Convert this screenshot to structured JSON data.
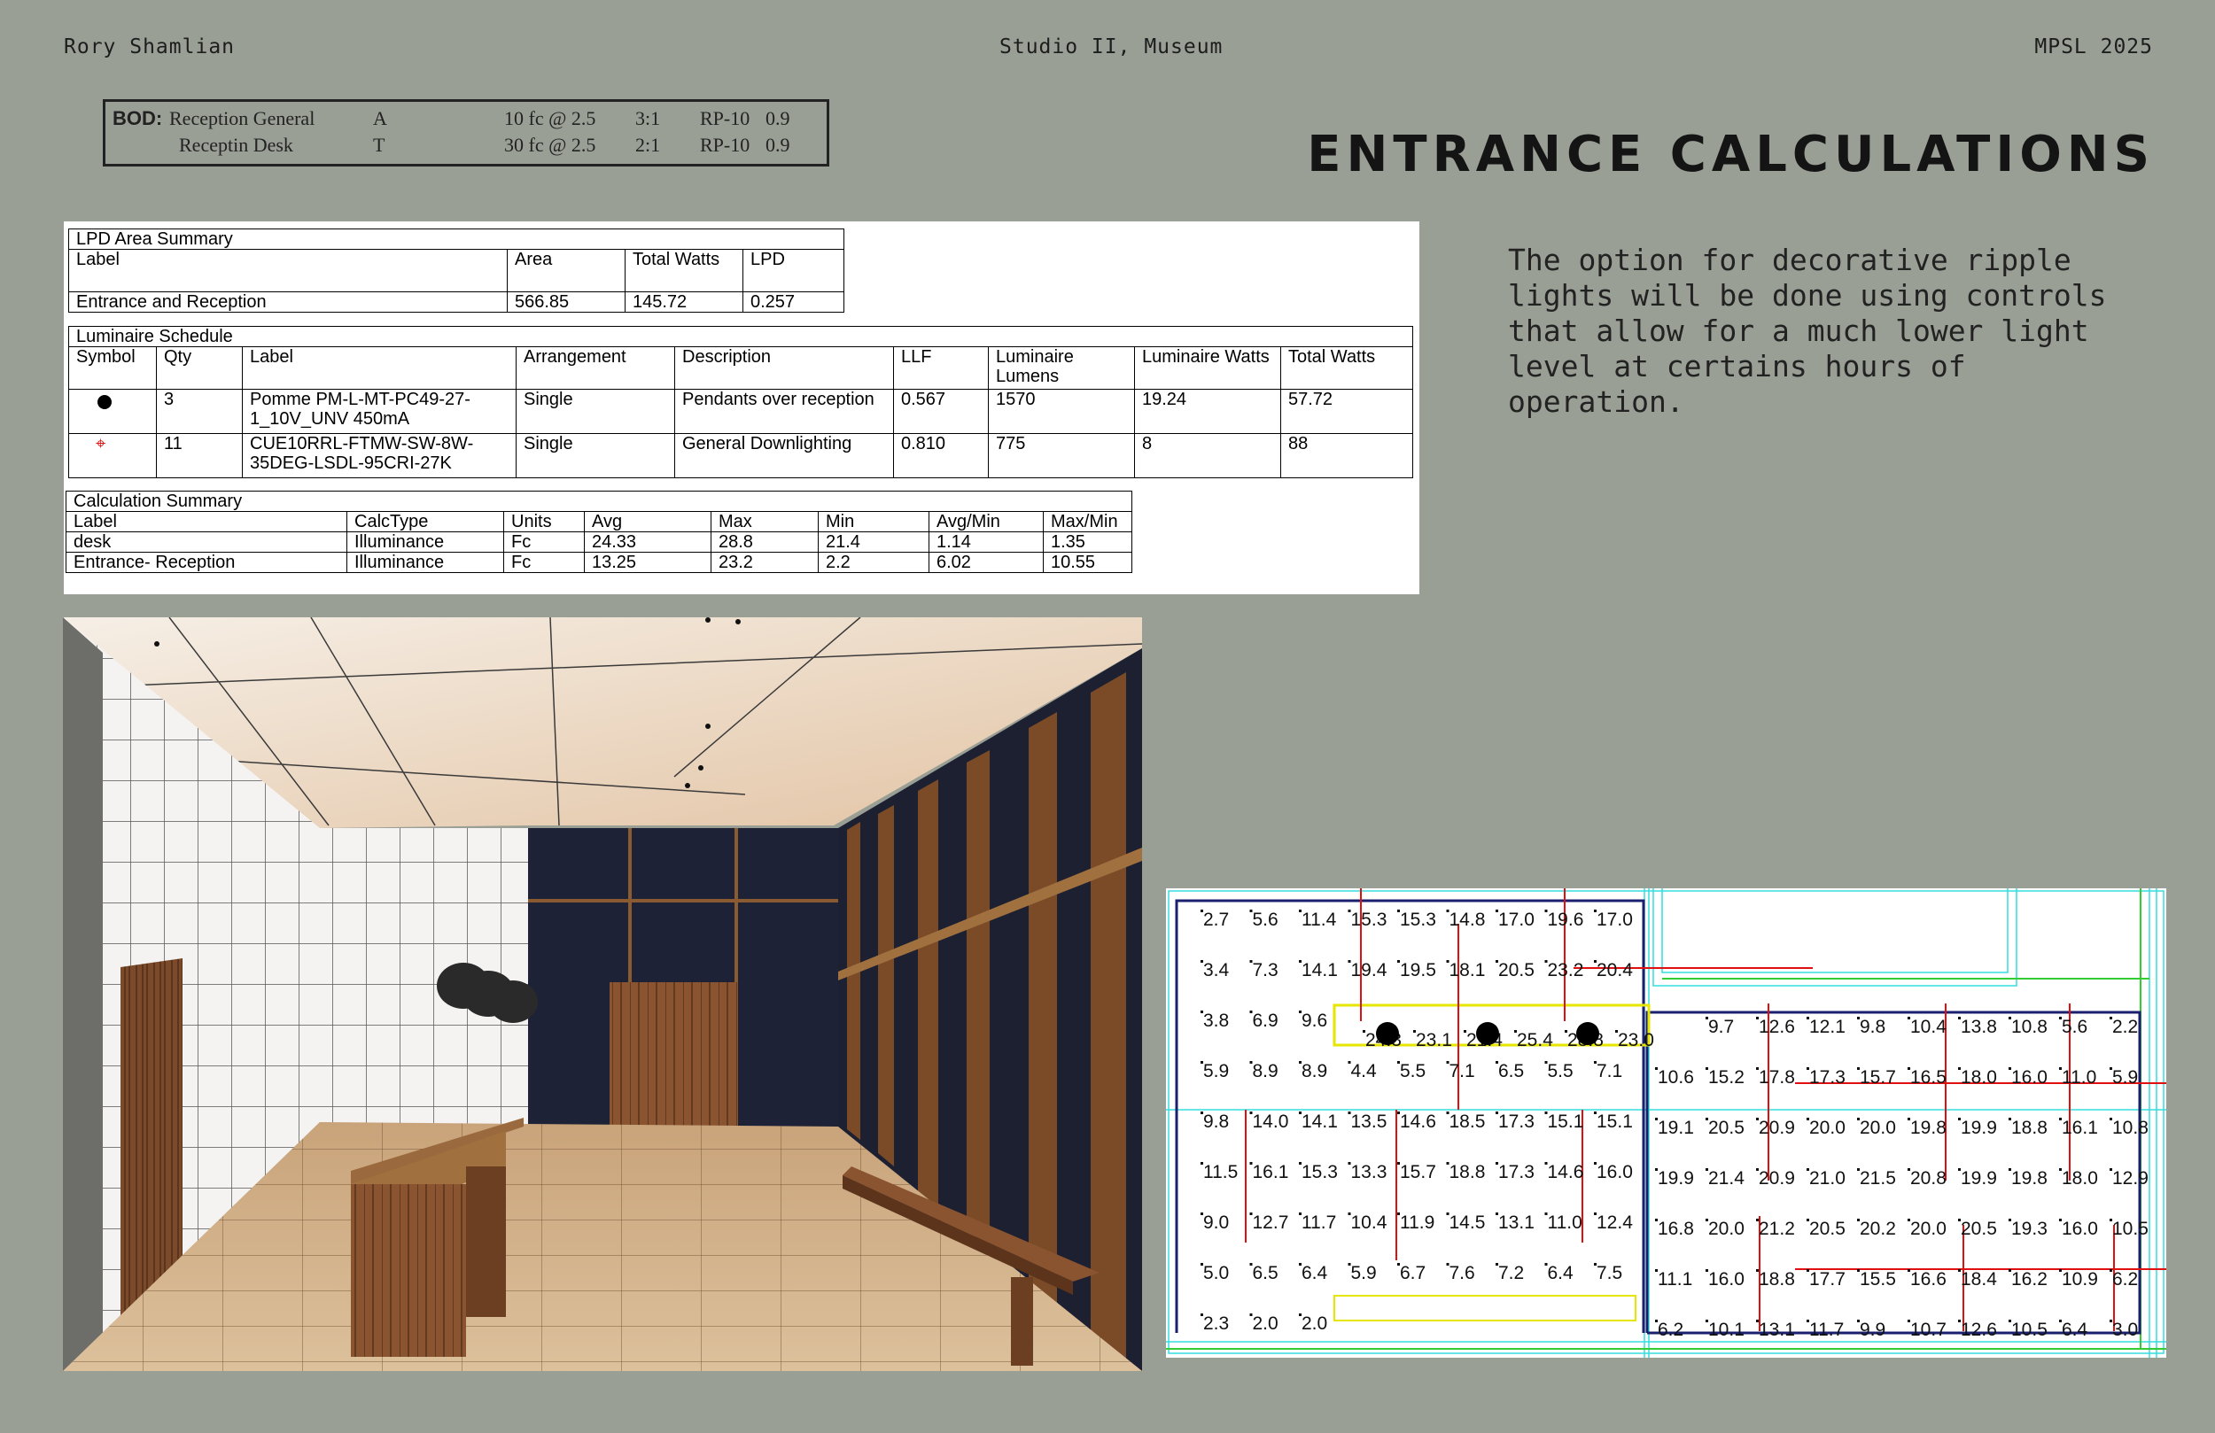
{
  "header": {
    "author": "Rory Shamlian",
    "course": "Studio II, Museum",
    "program": "MPSL 2025"
  },
  "title": "ENTRANCE CALCULATIONS",
  "description": "The option for decorative ripple lights will be done using controls that allow for a much lower light level at certains hours of operation.",
  "bod": {
    "label": "BOD:",
    "rows": [
      {
        "space": "Reception General",
        "cat": "A",
        "target": "10 fc @ 2.5",
        "ratio": "3:1",
        "ref": "RP-10",
        "val": "0.9"
      },
      {
        "space": "Receptin Desk",
        "cat": "T",
        "target": "30 fc @ 2.5",
        "ratio": "2:1",
        "ref": "RP-10",
        "val": "0.9"
      }
    ]
  },
  "lpd": {
    "title": "LPD Area Summary",
    "headers": [
      "Label",
      "Area",
      "Total Watts",
      "LPD"
    ],
    "row": [
      "Entrance and Reception",
      "566.85",
      "145.72",
      "0.257"
    ]
  },
  "schedule": {
    "title": "Luminaire Schedule",
    "headers": [
      "Symbol",
      "Qty",
      "Label",
      "Arrangement",
      "Description",
      "LLF",
      "Luminaire Lumens",
      "Luminaire Watts",
      "Total Watts"
    ],
    "rows": [
      {
        "symbol": "pendant-symbol",
        "qty": "3",
        "label": "Pomme PM-L-MT-PC49-27-1_10V_UNV 450mA",
        "arr": "Single",
        "desc": "Pendants over reception",
        "llf": "0.567",
        "lumens": "1570",
        "watts": "19.24",
        "total": "57.72"
      },
      {
        "symbol": "downlight-symbol",
        "qty": "11",
        "label": "CUE10RRL-FTMW-SW-8W-35DEG-LSDL-95CRI-27K",
        "arr": "Single",
        "desc": "General Downlighting",
        "llf": "0.810",
        "lumens": "775",
        "watts": "8",
        "total": "88"
      }
    ]
  },
  "calc": {
    "title": "Calculation Summary",
    "headers": [
      "Label",
      "CalcType",
      "Units",
      "Avg",
      "Max",
      "Min",
      "Avg/Min",
      "Max/Min"
    ],
    "rows": [
      [
        "desk",
        "Illuminance",
        "Fc",
        "24.33",
        "28.8",
        "21.4",
        "1.14",
        "1.35"
      ],
      [
        "Entrance- Reception",
        "Illuminance",
        "Fc",
        "13.25",
        "23.2",
        "2.2",
        "6.02",
        "10.55"
      ]
    ]
  },
  "plan": {
    "left_rows": [
      [
        "2.7",
        "5.6",
        "11.4",
        "15.3",
        "15.3",
        "14.8",
        "17.0",
        "19.6",
        "17.0"
      ],
      [
        "3.4",
        "7.3",
        "14.1",
        "19.4",
        "19.5",
        "18.1",
        "20.5",
        "23.2",
        "20.4"
      ],
      [
        "3.8",
        "6.9",
        "9.6",
        "",
        "",
        "",
        "",
        "",
        ""
      ],
      [
        "5.9",
        "8.9",
        "8.9",
        "4.4",
        "5.5",
        "7.1",
        "6.5",
        "5.5",
        "7.1"
      ],
      [
        "9.8",
        "14.0",
        "14.1",
        "13.5",
        "14.6",
        "18.5",
        "17.3",
        "15.1",
        "15.1"
      ],
      [
        "11.5",
        "16.1",
        "15.3",
        "13.3",
        "15.7",
        "18.8",
        "17.3",
        "14.6",
        "16.0"
      ],
      [
        "9.0",
        "12.7",
        "11.7",
        "10.4",
        "11.9",
        "14.5",
        "13.1",
        "11.0",
        "12.4"
      ],
      [
        "5.0",
        "6.5",
        "6.4",
        "5.9",
        "6.7",
        "7.6",
        "7.2",
        "6.4",
        "7.5"
      ],
      [
        "2.3",
        "2.0",
        "2.0",
        "",
        "",
        "",
        "",
        "",
        ""
      ]
    ],
    "desk_row": [
      "24.3",
      "23.1",
      "21.4",
      "25.4",
      "28.8",
      "23.0"
    ],
    "right_rows": [
      [
        "",
        "9.7",
        "12.6",
        "12.1",
        "9.8",
        "10.4",
        "13.8",
        "10.8",
        "5.6",
        "2.2"
      ],
      [
        "10.6",
        "15.2",
        "17.8",
        "17.3",
        "15.7",
        "16.5",
        "18.0",
        "16.0",
        "11.0",
        "5.9"
      ],
      [
        "19.1",
        "20.5",
        "20.9",
        "20.0",
        "20.0",
        "19.8",
        "19.9",
        "18.8",
        "16.1",
        "10.8"
      ],
      [
        "19.9",
        "21.4",
        "20.9",
        "21.0",
        "21.5",
        "20.8",
        "19.9",
        "19.8",
        "18.0",
        "12.9"
      ],
      [
        "16.8",
        "20.0",
        "21.2",
        "20.5",
        "20.2",
        "20.0",
        "20.5",
        "19.3",
        "16.0",
        "10.5"
      ],
      [
        "11.1",
        "16.0",
        "18.8",
        "17.7",
        "15.5",
        "16.6",
        "18.4",
        "16.2",
        "10.9",
        "6.2"
      ],
      [
        "6.2",
        "10.1",
        "13.1",
        "11.7",
        "9.9",
        "10.7",
        "12.6",
        "10.5",
        "6.4",
        "3.0"
      ]
    ]
  },
  "colors": {
    "background": "#9a9f96",
    "wall_blue": "#1a1f6e",
    "downlight_red": "#e01010",
    "guide_cyan": "#33dddd"
  }
}
